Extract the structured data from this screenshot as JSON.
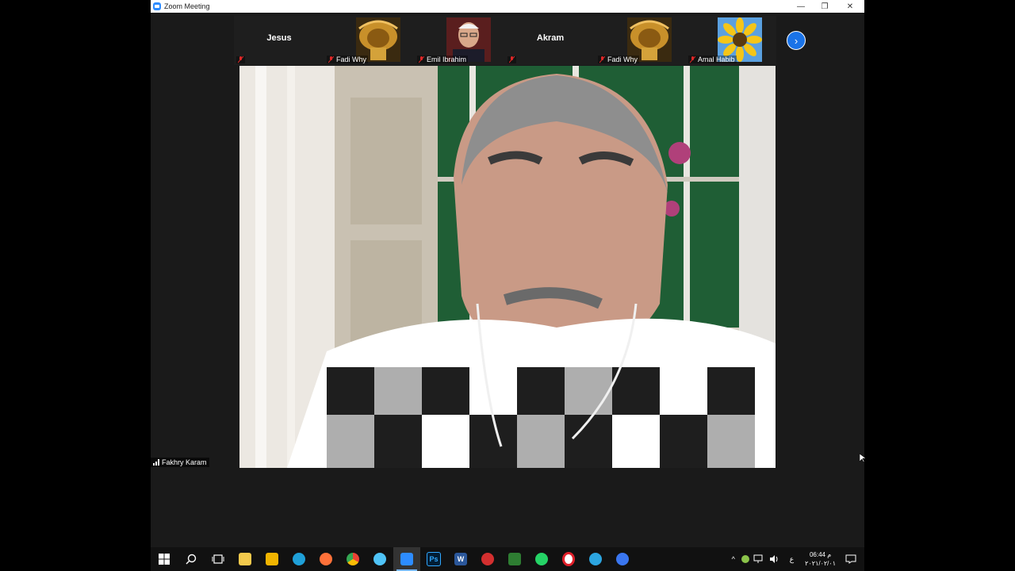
{
  "window": {
    "title": "Zoom Meeting",
    "controls": {
      "minimize": "—",
      "restore": "❐",
      "close": "✕"
    }
  },
  "gallery": {
    "tiles": [
      {
        "display": "Jesus",
        "label": ""
      },
      {
        "display": "",
        "label": "Fadi Why"
      },
      {
        "display": "",
        "label": "Emil Ibrahim"
      },
      {
        "display": "Akram",
        "label": ""
      },
      {
        "display": "",
        "label": "Fadi Why"
      },
      {
        "display": "",
        "label": "Amal Habib"
      }
    ],
    "next_icon": "›"
  },
  "speaker": {
    "name": "Fakhry Karam"
  },
  "taskbar": {
    "apps": [
      {
        "name": "start",
        "icon": "windows-logo",
        "color": "#ffffff"
      },
      {
        "name": "search",
        "icon": "search-icon",
        "color": "#ffffff"
      },
      {
        "name": "task-view",
        "icon": "task-view-icon",
        "color": "#ffffff"
      },
      {
        "name": "file-explorer",
        "icon": "folder-icon",
        "color": "#f2c94c"
      },
      {
        "name": "store",
        "icon": "store-icon",
        "color": "#f0b400"
      },
      {
        "name": "edge",
        "icon": "edge-icon",
        "color": "#1fa0d8"
      },
      {
        "name": "firefox",
        "icon": "firefox-icon",
        "color": "#ff7139"
      },
      {
        "name": "chrome",
        "icon": "chrome-icon",
        "color": "#4caf50"
      },
      {
        "name": "network-app",
        "icon": "globe-icon",
        "color": "#4fc3f7"
      },
      {
        "name": "zoom",
        "icon": "zoom-icon",
        "color": "#2d8cff"
      },
      {
        "name": "photoshop",
        "icon": "ps-icon",
        "color": "#001d34",
        "text": "Ps"
      },
      {
        "name": "word",
        "icon": "word-icon",
        "color": "#2b579a",
        "text": "W"
      },
      {
        "name": "anydesk-like",
        "icon": "app-icon",
        "color": "#d32f2f"
      },
      {
        "name": "dev-app",
        "icon": "code-icon",
        "color": "#2e7d32"
      },
      {
        "name": "whatsapp",
        "icon": "whatsapp-icon",
        "color": "#25d366"
      },
      {
        "name": "opera",
        "icon": "opera-icon",
        "color": "#e0202a"
      },
      {
        "name": "telegram",
        "icon": "telegram-icon",
        "color": "#2ca5e0"
      },
      {
        "name": "signal",
        "icon": "chat-icon",
        "color": "#3a76f0"
      }
    ],
    "tray": {
      "language": "ع",
      "time": "06:44 م",
      "date": "٢٠٢١/٠٢/٠١"
    }
  }
}
